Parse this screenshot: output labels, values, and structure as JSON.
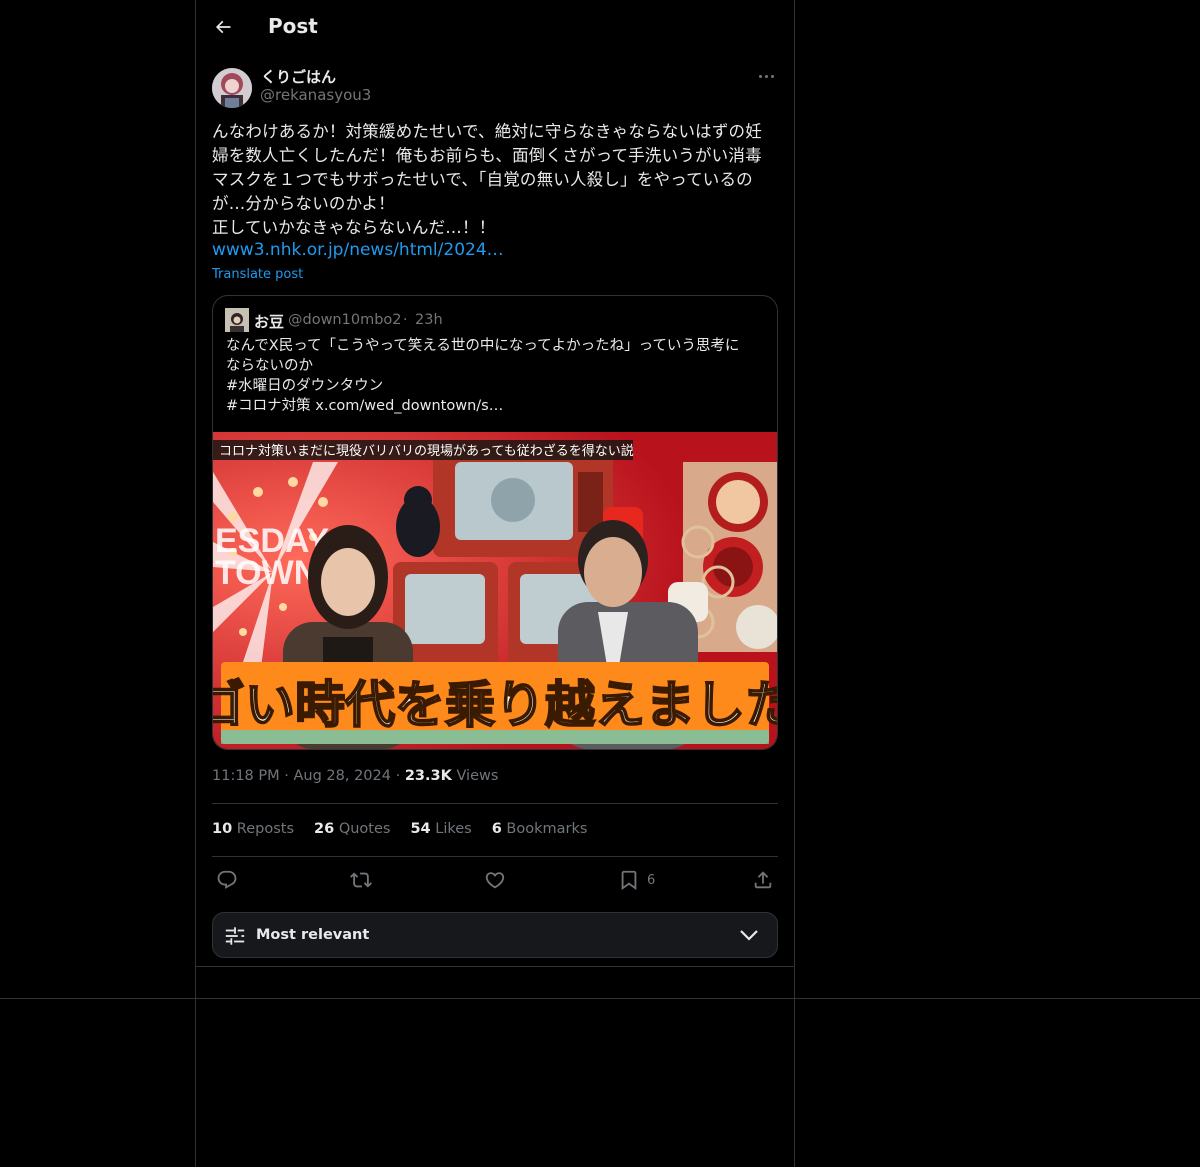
{
  "header": {
    "title": "Post"
  },
  "post": {
    "display_name": "くりごはん",
    "handle": "@rekanasyou3",
    "text": "んなわけあるか！対策緩めたせいで、絶対に守らなきゃならないはずの妊\n婦を数人亡くしたんだ！俺もお前らも、面倒くさがって手洗いうがい消毒\nマスクを１つでもサボったせいで、「自覚の無い人殺し」をやっているの\nが…分からないのかよ！\n正していかなきゃならないんだ…！！",
    "link": "www3.nhk.or.jp/news/html/2024…",
    "translate": "Translate post",
    "time": "11:18 PM",
    "date": "Aug 28, 2024",
    "views_count": "23.3K",
    "views_label": "Views"
  },
  "quote": {
    "display_name": "お豆",
    "handle": "@down10mbo2",
    "separator": "·",
    "time": "23h",
    "lines": [
      "なんでX民って「こうやって笑える世の中になってよかったね」っていう思考に",
      "ならないのか",
      "#水曜日のダウンタウン",
      "#コロナ対策  x.com/wed_downtown/s…"
    ],
    "media": {
      "top_caption": "コロナ対策いまだに現役バリバリの現場があっても従わざるを得ない説",
      "side_text_left": "ESDAY\nTOWN",
      "main_caption": "スゴい時代を乗り越えましたね"
    }
  },
  "stats": [
    {
      "count": "10",
      "label": "Reposts"
    },
    {
      "count": "26",
      "label": "Quotes"
    },
    {
      "count": "54",
      "label": "Likes"
    },
    {
      "count": "6",
      "label": "Bookmarks"
    }
  ],
  "actions": {
    "bookmark_count": "6"
  },
  "sort": {
    "label": "Most relevant"
  },
  "colors": {
    "background": "#000000",
    "border": "#2f3336",
    "text": "#e7e9ea",
    "muted": "#71767b",
    "link": "#1d9bf0",
    "sort_bg": "#16181c"
  },
  "icons": [
    "back-arrow-icon",
    "more-icon",
    "reply-icon",
    "repost-icon",
    "like-icon",
    "bookmark-icon",
    "share-icon",
    "sort-filter-icon",
    "chevron-down-icon"
  ]
}
